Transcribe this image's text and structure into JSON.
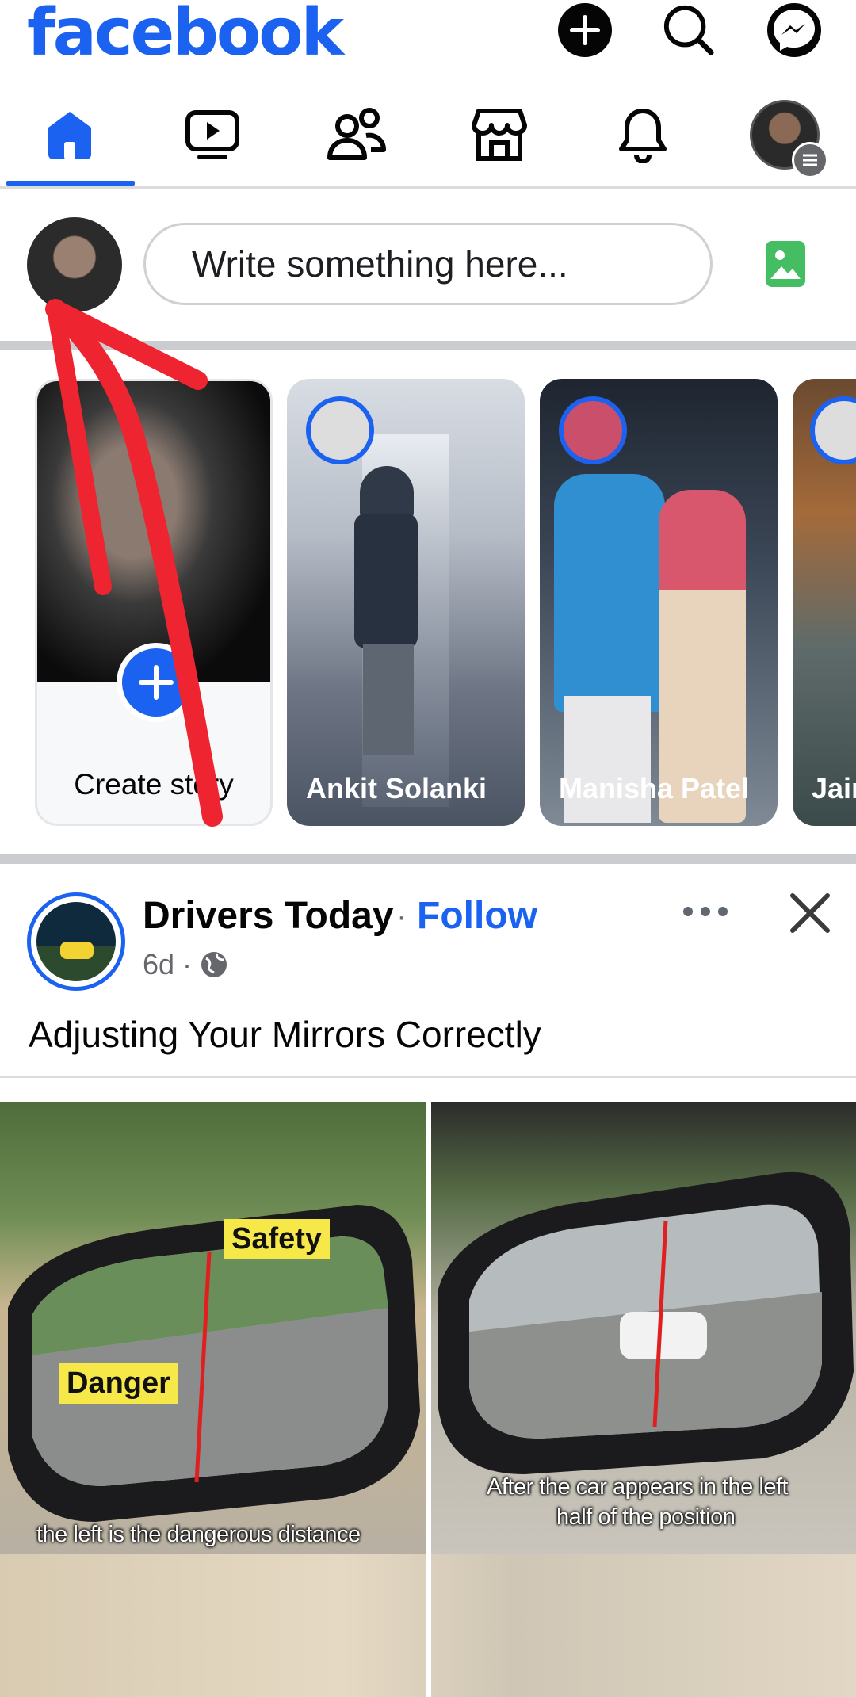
{
  "header": {
    "logo_text": "facebook",
    "brand_color": "#1b62f0",
    "actions": [
      "plus-icon",
      "search-icon",
      "messenger-icon"
    ]
  },
  "nav": {
    "tabs": [
      "home-icon",
      "video-icon",
      "friends-icon",
      "marketplace-icon",
      "bell-icon",
      "profile-menu"
    ],
    "active": "home-icon"
  },
  "composer": {
    "placeholder": "Write something here...",
    "photo_icon": "photo-icon"
  },
  "stories": {
    "create_label": "Create story",
    "items": [
      {
        "name": "Ankit Solanki"
      },
      {
        "name": "Manisha Patel"
      },
      {
        "name": "Jair"
      }
    ]
  },
  "post": {
    "author": "Drivers Today",
    "separator": "·",
    "follow_label": "Follow",
    "time": "6d ·",
    "caption": "Adjusting Your Mirrors Correctly",
    "image": {
      "label_safety": "Safety",
      "label_danger": "Danger",
      "subtitle_left": "the left is the dangerous distance",
      "subtitle_right_1": "After the car appears in the left",
      "subtitle_right_2": "half of the position"
    }
  }
}
